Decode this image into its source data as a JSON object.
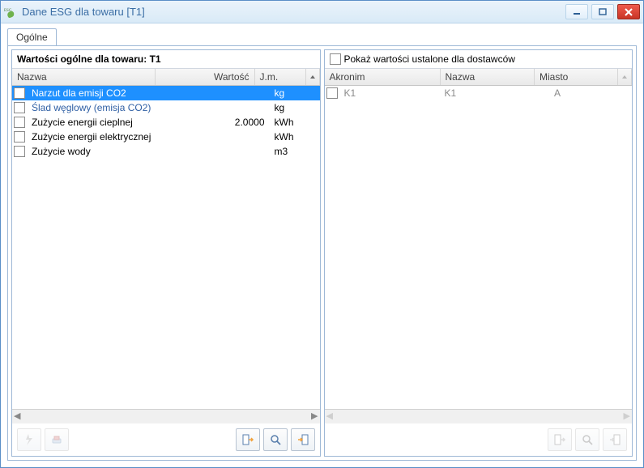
{
  "window": {
    "title": "Dane ESG dla towaru [T1]",
    "app_icon_label": "ESG"
  },
  "tabs": {
    "general": "Ogólne"
  },
  "left_panel": {
    "header": "Wartości ogólne dla towaru: T1",
    "columns": {
      "name": "Nazwa",
      "value": "Wartość",
      "unit": "J.m."
    },
    "rows": [
      {
        "name": "Narzut dla emisji CO2",
        "value": "",
        "unit": "kg",
        "selected": true
      },
      {
        "name": "Ślad węglowy (emisja CO2)",
        "value": "",
        "unit": "kg",
        "selected": false
      },
      {
        "name": "Zużycie energii cieplnej",
        "value": "2.0000",
        "unit": "kWh",
        "selected": false
      },
      {
        "name": "Zużycie energii elektrycznej",
        "value": "",
        "unit": "kWh",
        "selected": false
      },
      {
        "name": "Zużycie wody",
        "value": "",
        "unit": "m3",
        "selected": false
      }
    ]
  },
  "right_panel": {
    "checkbox_label": "Pokaż wartości ustalone dla dostawców",
    "columns": {
      "acronym": "Akronim",
      "name": "Nazwa",
      "city": "Miasto"
    },
    "rows": [
      {
        "acronym": "K1",
        "name": "K1",
        "city": "A"
      }
    ]
  }
}
